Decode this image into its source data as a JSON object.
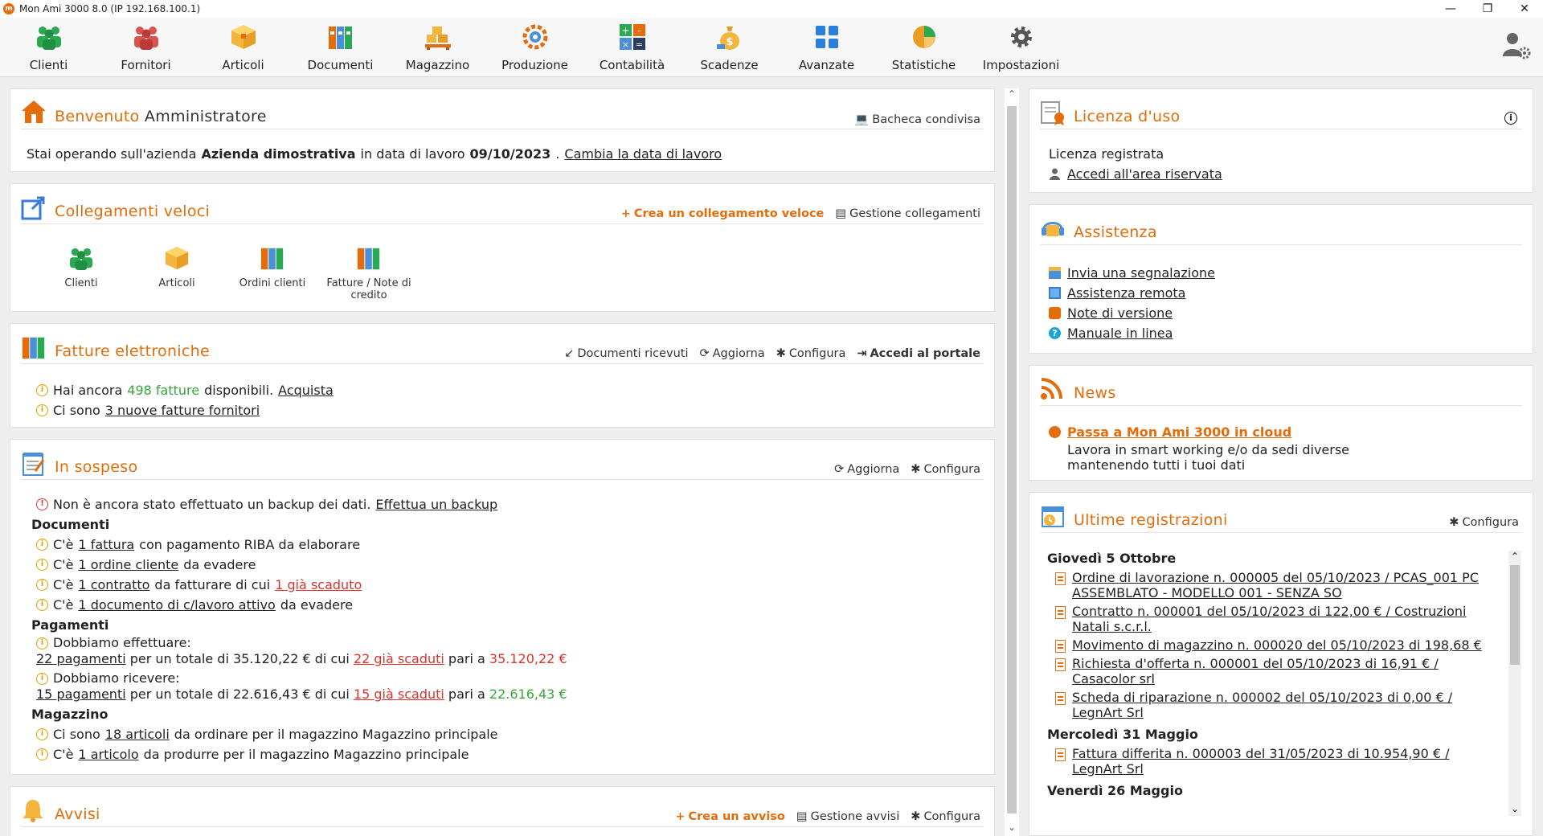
{
  "window": {
    "title": "Mon Ami 3000 8.0 (IP 192.168.100.1)",
    "minimize": "—",
    "maximize": "❐",
    "close": "✕"
  },
  "toolbar": [
    {
      "label": "Clienti"
    },
    {
      "label": "Fornitori"
    },
    {
      "label": "Articoli"
    },
    {
      "label": "Documenti"
    },
    {
      "label": "Magazzino"
    },
    {
      "label": "Produzione"
    },
    {
      "label": "Contabilità"
    },
    {
      "label": "Scadenze"
    },
    {
      "label": "Avanzate"
    },
    {
      "label": "Statistiche"
    },
    {
      "label": "Impostazioni"
    }
  ],
  "welcome": {
    "title_a": "Benvenuto",
    "title_b": "Amministratore",
    "action": "Bacheca condivisa",
    "t1": "Stai operando sull'azienda",
    "company": "Azienda dimostrativa",
    "t2": "in data di lavoro",
    "date": "09/10/2023",
    "change_link": "Cambia la data di lavoro"
  },
  "quicklinks": {
    "title": "Collegamenti veloci",
    "create": "Crea un collegamento veloce",
    "manage": "Gestione collegamenti",
    "items": [
      {
        "label": "Clienti"
      },
      {
        "label": "Articoli"
      },
      {
        "label": "Ordini clienti"
      },
      {
        "label": "Fatture / Note di credito"
      }
    ]
  },
  "einvoices": {
    "title": "Fatture elettroniche",
    "received": "Documenti ricevuti",
    "refresh": "Aggiorna",
    "configure": "Configura",
    "portal": "Accedi al portale",
    "l1a": "Hai ancora",
    "l1b": "498 fatture",
    "l1c": "disponibili.",
    "l1link": "Acquista",
    "l2a": "Ci sono",
    "l2link": "3 nuove fatture fornitori"
  },
  "pending": {
    "title": "In sospeso",
    "refresh": "Aggiorna",
    "configure": "Configura",
    "backup_text": "Non è ancora stato effettuato un backup dei dati.",
    "backup_link": "Effettua un backup",
    "docs_title": "Documenti",
    "d1a": "C'è",
    "d1link": "1 fattura",
    "d1b": "con pagamento RIBA da elaborare",
    "d2a": "C'è",
    "d2link": "1 ordine cliente",
    "d2b": "da evadere",
    "d3a": "C'è",
    "d3link": "1 contratto",
    "d3b": "da fatturare di cui",
    "d3link2": "1 già scaduto",
    "d4a": "C'è",
    "d4link": "1 documento di c/lavoro attivo",
    "d4b": "da evadere",
    "pay_title": "Pagamenti",
    "p1": "Dobbiamo effettuare:",
    "p1link": "22 pagamenti",
    "p1b": "per un totale di 35.120,22 € di cui",
    "p1link2": "22 già scaduti",
    "p1c": "pari a",
    "p1amt": "35.120,22 €",
    "p2": "Dobbiamo ricevere:",
    "p2link": "15 pagamenti",
    "p2b": "per un totale di 22.616,43 € di cui",
    "p2link2": "15 già scaduti",
    "p2c": "pari a",
    "p2amt": "22.616,43 €",
    "wh_title": "Magazzino",
    "w1a": "Ci sono",
    "w1link": "18 articoli",
    "w1b": "da ordinare per il magazzino Magazzino principale",
    "w2a": "C'è",
    "w2link": "1 articolo",
    "w2b": "da produrre per il magazzino Magazzino principale"
  },
  "alerts": {
    "title": "Avvisi",
    "create": "Crea un avviso",
    "manage": "Gestione avvisi",
    "configure": "Configura"
  },
  "license": {
    "title": "Licenza d'uso",
    "status": "Licenza registrata",
    "link": "Accedi all'area riservata"
  },
  "support": {
    "title": "Assistenza",
    "links": [
      {
        "label": "Invia una segnalazione"
      },
      {
        "label": "Assistenza remota"
      },
      {
        "label": "Note di versione"
      },
      {
        "label": "Manuale in linea"
      }
    ]
  },
  "news": {
    "title": "News",
    "headline": "Passa a Mon Ami 3000 in cloud",
    "body": "Lavora in smart working e/o da sedi diverse mantenendo tutti i tuoi dati"
  },
  "registrations": {
    "title": "Ultime registrazioni",
    "configure": "Configura",
    "day1": "Giovedì 5 Ottobre",
    "items1": [
      {
        "text": "Ordine di lavorazione n. 000005 del 05/10/2023 / PCAS_001 PC ASSEMBLATO - MODELLO 001 - SENZA SO"
      },
      {
        "text": "Contratto n. 000001 del 05/10/2023 di 122,00 € / Costruzioni Natali s.c.r.l."
      },
      {
        "text": "Movimento di magazzino n. 000020 del 05/10/2023 di 198,68 €"
      },
      {
        "text": "Richiesta d'offerta n. 000001 del 05/10/2023 di 16,91 € / Casacolor srl"
      },
      {
        "text": "Scheda di riparazione n. 000002 del 05/10/2023 di 0,00 € / LegnArt Srl"
      }
    ],
    "day2": "Mercoledì 31 Maggio",
    "items2": [
      {
        "text": "Fattura differita n. 000003 del 31/05/2023 di 10.954,90 € / LegnArt Srl"
      }
    ],
    "day3": "Venerdì 26 Maggio"
  }
}
